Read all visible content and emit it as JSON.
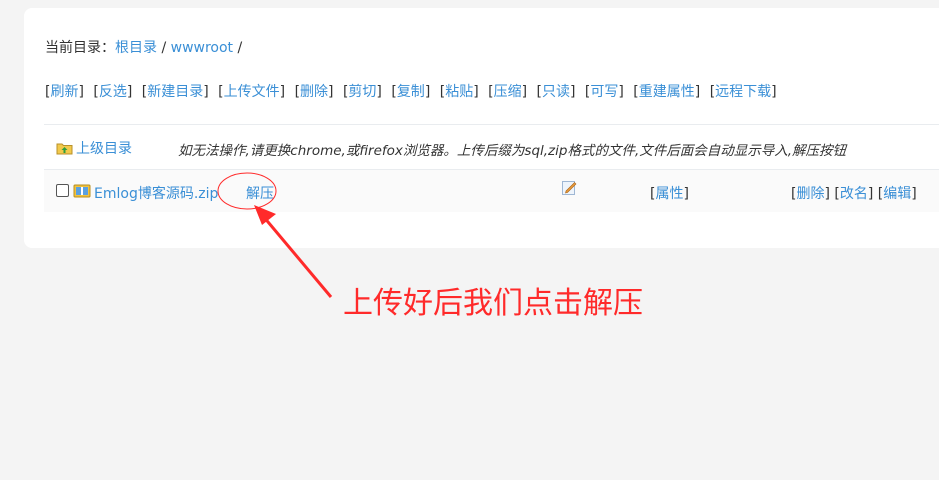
{
  "breadcrumb": {
    "label": "当前目录：",
    "root": "根目录",
    "sep1": " / ",
    "folder": "wwwroot",
    "sep2": " /"
  },
  "toolbar": [
    "刷新",
    "反选",
    "新建目录",
    "上传文件",
    "删除",
    "剪切",
    "复制",
    "粘贴",
    "压缩",
    "只读",
    "可写",
    "重建属性",
    "远程下载"
  ],
  "table": {
    "updir_label": "上级目录",
    "note": "如无法操作,请更换chrome,或firefox浏览器。上传后缀为sql,zip格式的文件,文件后面会自动显示导入,解压按钮",
    "file": {
      "name": "Emlog博客源码.zip",
      "unzip": "解压",
      "attr": "属性",
      "delete": "删除",
      "rename": "改名",
      "edit": "编辑"
    }
  },
  "annotation": {
    "text": "上传好后我们点击解压",
    "color": "#ff2a2a"
  },
  "colors": {
    "link": "#3a8fd6",
    "background": "#f4f4f4",
    "card": "#ffffff"
  }
}
